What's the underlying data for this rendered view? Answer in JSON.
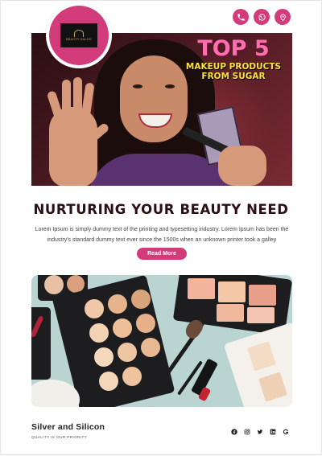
{
  "brand": {
    "logo_text": "BEAUTY SALON",
    "name": "Silver and Silicon",
    "tagline": "QUALITY IS OUR PRIORITY"
  },
  "header": {
    "icons": [
      "phone-icon",
      "whatsapp-icon",
      "location-icon"
    ],
    "accent_color": "#d23c7a"
  },
  "hero": {
    "headline_big": "TOP 5",
    "headline_small": "MAKEUP PRODUCTS FROM SUGAR"
  },
  "section": {
    "title": "NURTURING YOUR BEAUTY NEED",
    "body": "Lorem Ipsum is simply dummy text of the printing and typesetting industry. Lorem Ipsum has been the industry's standard dummy text ever since the 1500s when an unknown printer took a galley",
    "button_label": "Read More"
  },
  "footer": {
    "social_icons": [
      "facebook-icon",
      "instagram-icon",
      "twitter-icon",
      "linkedin-icon",
      "google-icon"
    ]
  }
}
